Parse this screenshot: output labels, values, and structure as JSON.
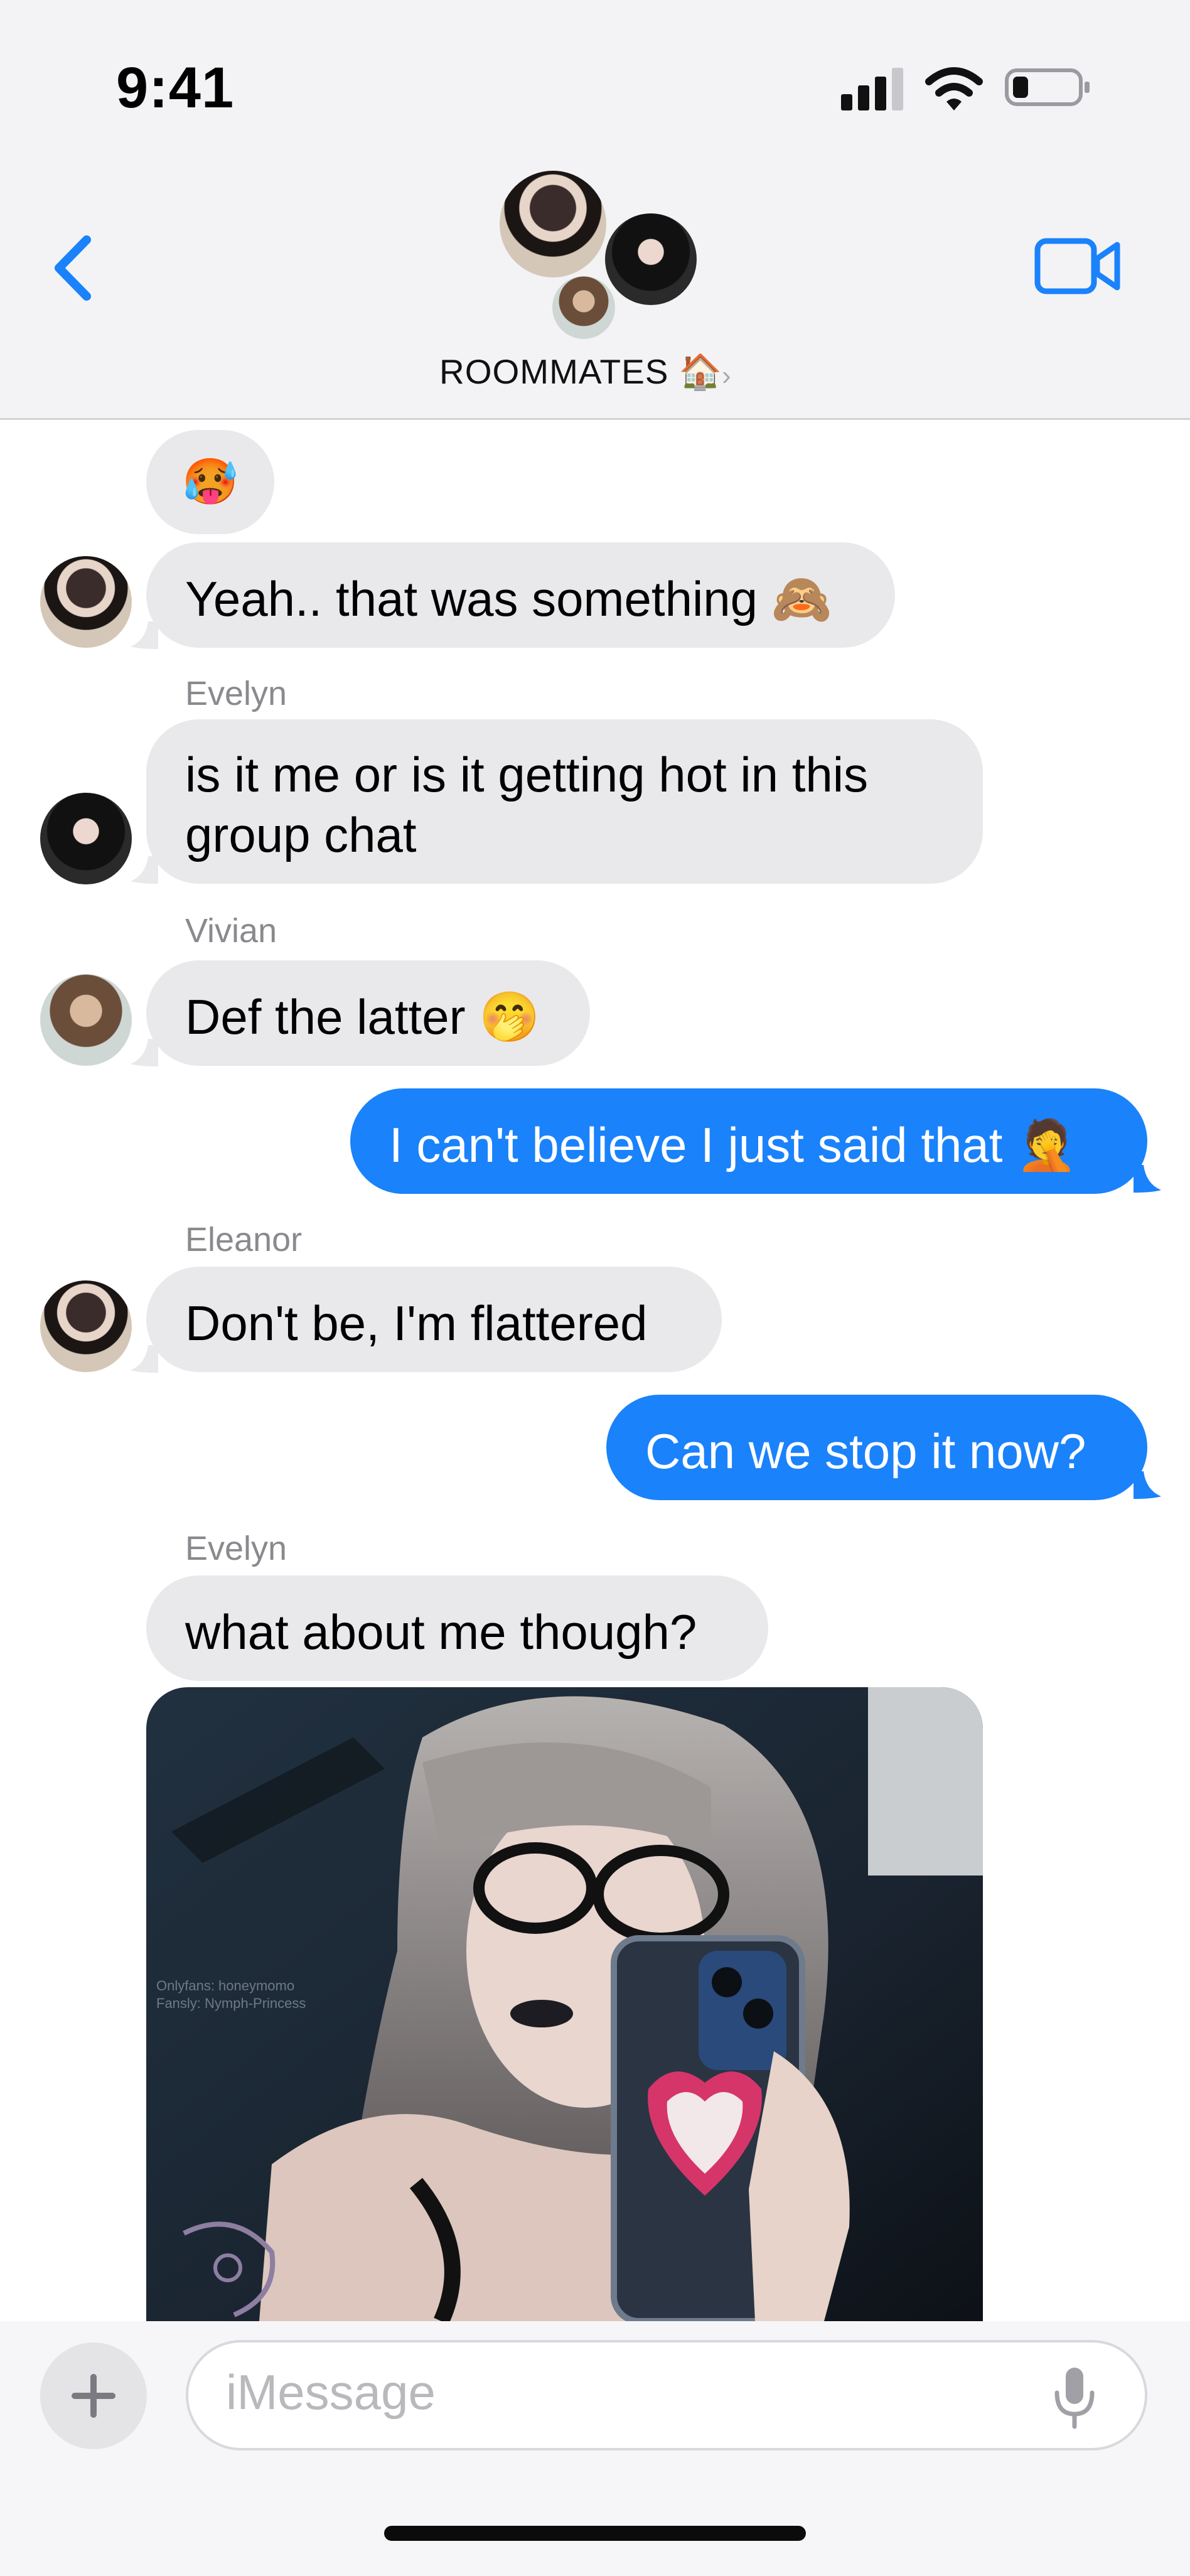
{
  "status_bar": {
    "time": "9:41"
  },
  "header": {
    "group_name": "ROOMMATES",
    "group_emoji": "🏠",
    "chevron": "›"
  },
  "messages": {
    "m0": {
      "emoji": "🥵"
    },
    "m1": {
      "text": "Yeah.. that was something 🙈"
    },
    "m2": {
      "sender": "Evelyn",
      "line1": "is it me or is it getting hot in this",
      "line2": "group chat"
    },
    "m3": {
      "sender": "Vivian",
      "text": "Def the latter 🤭"
    },
    "m4": {
      "text": "I can't believe I just said that 🤦"
    },
    "m5": {
      "sender": "Eleanor",
      "text": "Don't be, I'm flattered"
    },
    "m6": {
      "text": "Can we stop it now?"
    },
    "m7": {
      "sender": "Evelyn",
      "text": "what about me though?"
    },
    "photo_watermark": {
      "line1": "Onlyfans: honeymomo",
      "line2": "Fansly: Nymph-Princess"
    }
  },
  "composer": {
    "placeholder": "iMessage",
    "plus": "+"
  },
  "colors": {
    "accent": "#1a82fb",
    "received_bubble": "#e9e9eb",
    "header_bg": "#f3f3f5"
  },
  "icons": [
    "signal-icon",
    "wifi-icon",
    "battery-icon",
    "back-chevron-icon",
    "video-call-icon",
    "plus-icon",
    "microphone-icon"
  ]
}
